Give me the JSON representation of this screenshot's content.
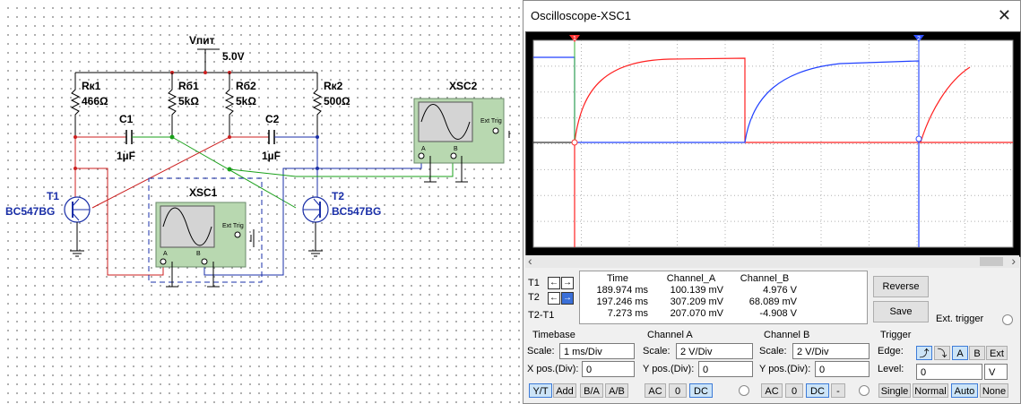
{
  "schematic": {
    "supply": {
      "name": "Vпит",
      "value": "5.0V"
    },
    "components": {
      "rk1": {
        "name": "Rк1",
        "value": "466Ω"
      },
      "rb1": {
        "name": "Rб1",
        "value": "5kΩ"
      },
      "rb2": {
        "name": "Rб2",
        "value": "5kΩ"
      },
      "rk2": {
        "name": "Rк2",
        "value": "500Ω"
      },
      "c1": {
        "name": "C1",
        "value": "1µF"
      },
      "c2": {
        "name": "C2",
        "value": "1µF"
      },
      "t1": {
        "name": "T1",
        "model": "BC547BG"
      },
      "t2": {
        "name": "T2",
        "model": "BC547BG"
      }
    },
    "scope1": {
      "name": "XSC1",
      "ext_trig": "Ext Trig",
      "pin_a": "A",
      "pin_b": "B"
    },
    "scope2": {
      "name": "XSC2",
      "ext_trig": "Ext Trig",
      "pin_a": "A",
      "pin_b": "B"
    }
  },
  "window": {
    "title": "Oscilloscope-XSC1",
    "close": "✕"
  },
  "scroll": {
    "left": "‹",
    "right": "›"
  },
  "cursors": {
    "t1_label": "T1",
    "t2_label": "T2",
    "t2t1_label": "T2-T1",
    "arrow_left": "←",
    "arrow_right": "→",
    "headers": {
      "time": "Time",
      "a": "Channel_A",
      "b": "Channel_B"
    },
    "rows": [
      {
        "time": "189.974 ms",
        "a": "100.139 mV",
        "b": "4.976 V"
      },
      {
        "time": "197.246 ms",
        "a": "307.209 mV",
        "b": "68.089 mV"
      },
      {
        "time": "7.273 ms",
        "a": "207.070 mV",
        "b": "-4.908 V"
      }
    ]
  },
  "buttons": {
    "reverse": "Reverse",
    "save": "Save",
    "ext_trigger": "Ext. trigger"
  },
  "timebase": {
    "title": "Timebase",
    "scale_label": "Scale:",
    "scale": "1 ms/Div",
    "xpos_label": "X pos.(Div):",
    "xpos": "0",
    "modes": [
      "Y/T",
      "Add",
      "B/A",
      "A/B"
    ],
    "active_mode": "Y/T"
  },
  "channel_a": {
    "title": "Channel A",
    "scale_label": "Scale:",
    "scale": "2  V/Div",
    "ypos_label": "Y pos.(Div):",
    "ypos": "0",
    "coupling": [
      "AC",
      "0",
      "DC"
    ],
    "active": "DC"
  },
  "channel_b": {
    "title": "Channel B",
    "scale_label": "Scale:",
    "scale": "2  V/Div",
    "ypos_label": "Y pos.(Div):",
    "ypos": "0",
    "coupling": [
      "AC",
      "0",
      "DC",
      "-"
    ],
    "active": "DC"
  },
  "trigger": {
    "title": "Trigger",
    "edge_label": "Edge:",
    "level_label": "Level:",
    "level": "0",
    "level_unit": "V",
    "edge_buttons": [
      "⤴",
      "⤵",
      "A",
      "B",
      "Ext"
    ],
    "active_edge": "A",
    "modes": [
      "Single",
      "Normal",
      "Auto",
      "None"
    ],
    "active_mode": "Auto"
  },
  "colors": {
    "trace_a": "#ff2020",
    "trace_b": "#2040ff",
    "cursor1": "#ff3030",
    "cursor2": "#3050ff",
    "grid": "#444444",
    "wire_red": "#cc1f1f",
    "wire_blue": "#1a2fa8",
    "wire_green": "#1aa01a"
  },
  "cursor_markers": {
    "t1": "1",
    "t2": "2"
  }
}
